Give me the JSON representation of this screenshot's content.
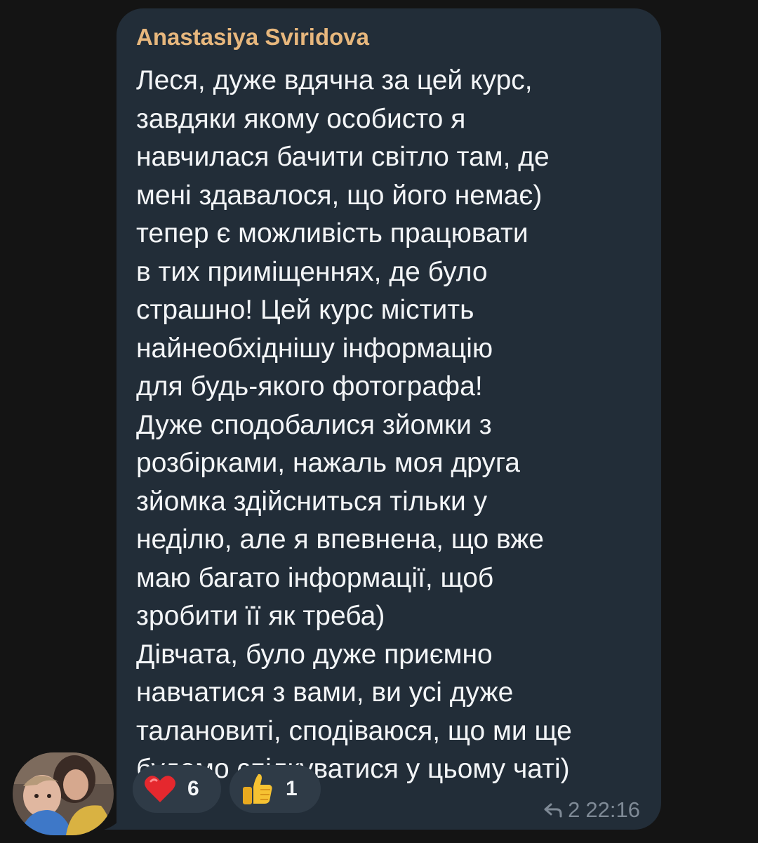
{
  "message": {
    "sender_name": "Anastasiya Sviridova",
    "lines": [
      "Леся, дуже вдячна за цей курс,",
      "завдяки якому особисто я",
      "навчилася бачити світло там, де",
      "мені здавалося, що його немає)",
      "тепер є можливість працювати",
      "в тих приміщеннях, де було",
      "страшно! Цей курс містить",
      "найнеобхіднішу інформацію",
      "для будь-якого фотографа!",
      "Дуже сподобалися зйомки з",
      "розбірками, нажаль моя друга",
      "зйомка здійсниться тільки у",
      "неділю, але я впевнена, що вже",
      "маю багато інформації, щоб",
      "зробити її як треба)",
      "Дівчата, було дуже приємно",
      "навчатися з вами, ви усі дуже",
      "талановиті, сподіваюся, що ми ще",
      "будемо спілкуватися у цьому чаті)"
    ],
    "reactions": [
      {
        "emoji_icon": "red-heart-icon",
        "count": "6"
      },
      {
        "emoji_icon": "thumbs-up-icon",
        "count": "1"
      }
    ],
    "reply_count": "2",
    "time": "22:16"
  },
  "colors": {
    "background": "#141414",
    "bubble": "#222d38",
    "sender_name": "#e7b77d",
    "text": "#f3f5f7",
    "reaction_pill": "#2f3b47",
    "meta_text": "#7f8a96"
  }
}
